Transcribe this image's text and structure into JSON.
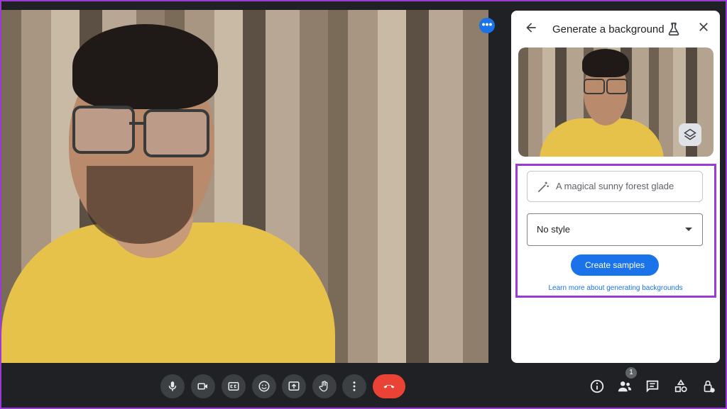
{
  "panel": {
    "title": "Generate a background",
    "prompt_placeholder": "A magical sunny forest glade",
    "style_value": "No style",
    "create_button": "Create samples",
    "learn_more": "Learn more about generating backgrounds"
  },
  "controls": {
    "people_count": "1",
    "more_dots": "•••"
  },
  "colors": {
    "accent": "#1a73e8",
    "end_call": "#ea4335",
    "highlight": "#9b3bd6",
    "control_bg": "#3c4043"
  },
  "icons": [
    "arrow-back-icon",
    "flask-icon",
    "close-icon",
    "layers-icon",
    "magic-wand-icon",
    "dropdown-caret-icon",
    "mic-icon",
    "camera-icon",
    "captions-icon",
    "emoji-icon",
    "present-icon",
    "raise-hand-icon",
    "more-vert-icon",
    "end-call-icon",
    "info-icon",
    "people-icon",
    "chat-icon",
    "activities-icon",
    "host-controls-icon"
  ]
}
